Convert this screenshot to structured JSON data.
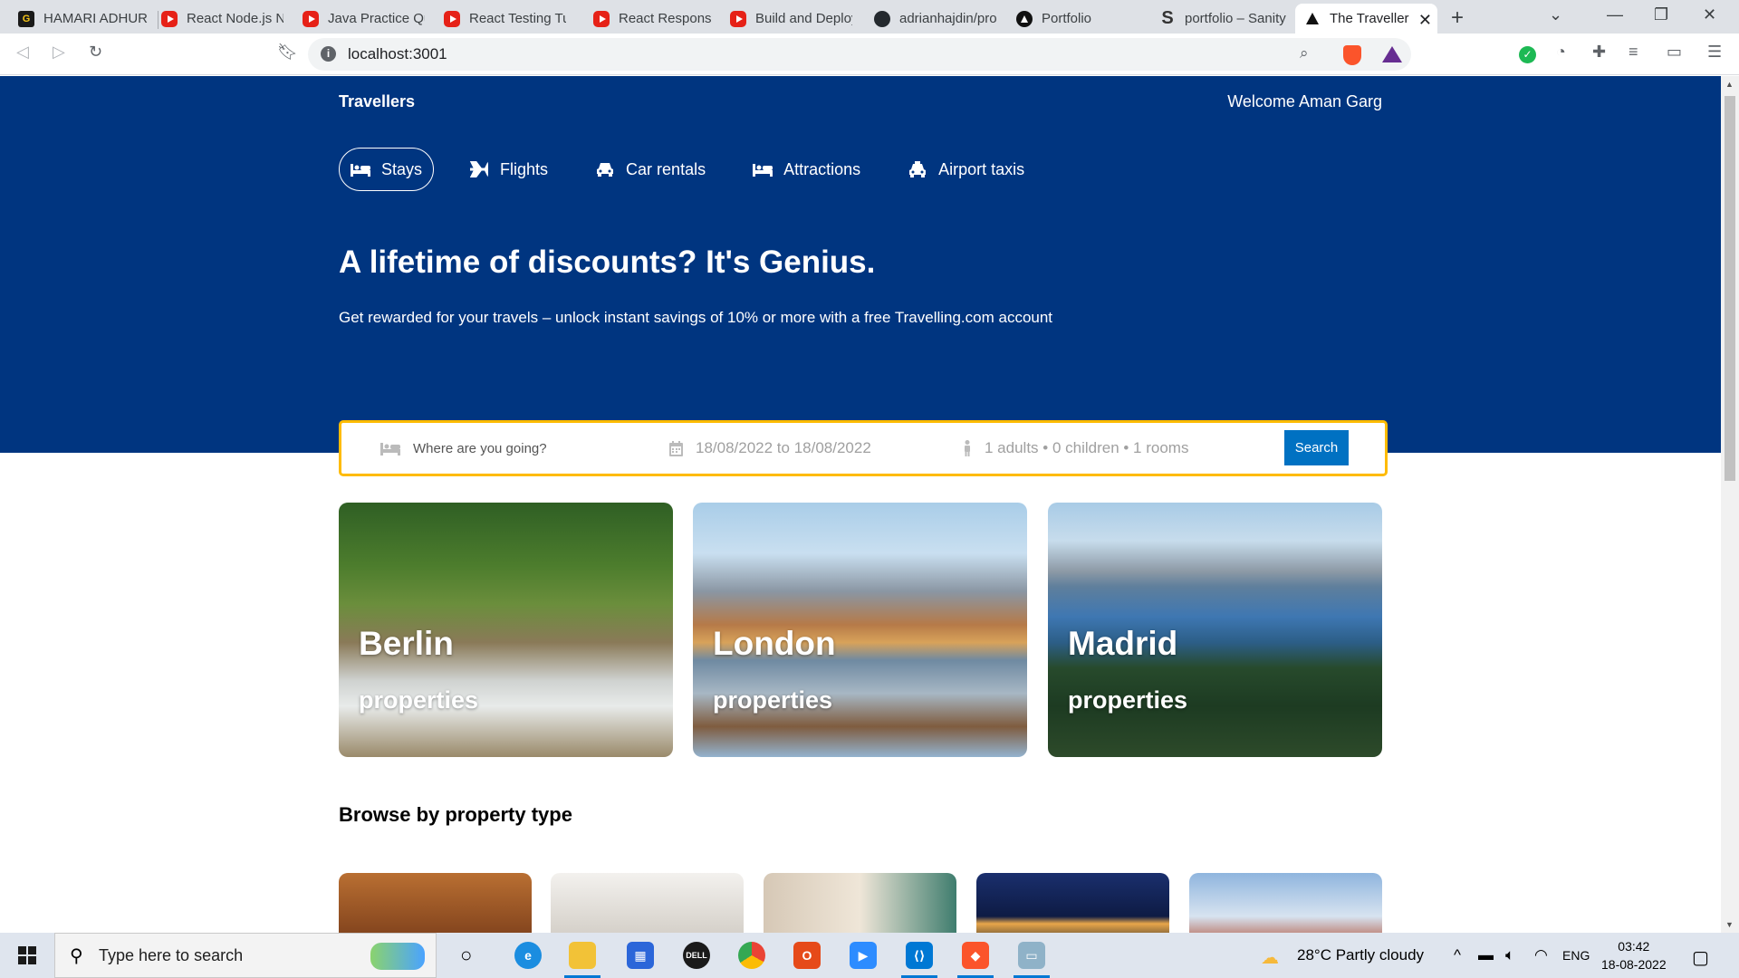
{
  "browser": {
    "tabs": [
      {
        "title": "HAMARI ADHURI",
        "icon": "gamma-icon"
      },
      {
        "title": "React Node.js Ne",
        "icon": "youtube-icon"
      },
      {
        "title": "Java Practice Que",
        "icon": "youtube-icon"
      },
      {
        "title": "React Testing Tut",
        "icon": "youtube-icon"
      },
      {
        "title": "React Responsive",
        "icon": "youtube-icon"
      },
      {
        "title": "Build and Deploy",
        "icon": "youtube-icon"
      },
      {
        "title": "adrianhajdin/pro",
        "icon": "github-icon"
      },
      {
        "title": "Portfolio",
        "icon": "portfolio-icon"
      },
      {
        "title": "portfolio – Sanity",
        "icon": "sanity-icon"
      },
      {
        "title": "The Traveller",
        "icon": "vercel-icon",
        "active": true
      }
    ],
    "new_tab": "+",
    "url": "localhost:3001"
  },
  "header": {
    "logo": "Travellers",
    "welcome": "Welcome Aman Garg"
  },
  "nav": {
    "items": [
      {
        "label": "Stays",
        "icon": "bed-icon",
        "active": true
      },
      {
        "label": "Flights",
        "icon": "plane-icon"
      },
      {
        "label": "Car rentals",
        "icon": "car-icon"
      },
      {
        "label": "Attractions",
        "icon": "bed-icon"
      },
      {
        "label": "Airport taxis",
        "icon": "taxi-icon"
      }
    ]
  },
  "hero": {
    "title": "A lifetime of discounts? It's Genius.",
    "description": "Get rewarded for your travels – unlock instant savings of 10% or more with a free Travelling.com account"
  },
  "search": {
    "destination_placeholder": "Where are you going?",
    "dates": "18/08/2022 to 18/08/2022",
    "options": "1 adults • 0 children • 1 rooms",
    "button": "Search"
  },
  "featured": [
    {
      "city": "Berlin",
      "subtitle": "properties"
    },
    {
      "city": "London",
      "subtitle": "properties"
    },
    {
      "city": "Madrid",
      "subtitle": "properties"
    }
  ],
  "property_section": {
    "title": "Browse by property type"
  },
  "taskbar": {
    "search_placeholder": "Type here to search",
    "weather": "28°C  Partly cloudy",
    "lang": "ENG",
    "time": "03:42",
    "date": "18-08-2022"
  },
  "colors": {
    "brand_blue": "#003580",
    "search_border": "#febb02",
    "button_blue": "#0071c2"
  }
}
